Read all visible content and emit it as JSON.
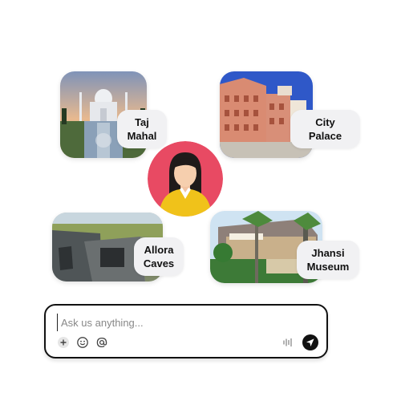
{
  "places": [
    {
      "line1": "Taj",
      "line2": "Mahal"
    },
    {
      "line1": "City",
      "line2": "Palace"
    },
    {
      "line1": "Allora",
      "line2": "Caves"
    },
    {
      "line1": "Jhansi",
      "line2": "Museum"
    }
  ],
  "chat": {
    "placeholder": "Ask us anything..."
  },
  "icons": {
    "add": "plus-icon",
    "emoji": "smiley-icon",
    "mention": "at-icon",
    "voice": "waveform-icon",
    "send": "send-icon"
  },
  "colors": {
    "avatar_bg": "#e84a63",
    "label_bg": "#f1f1f3"
  }
}
